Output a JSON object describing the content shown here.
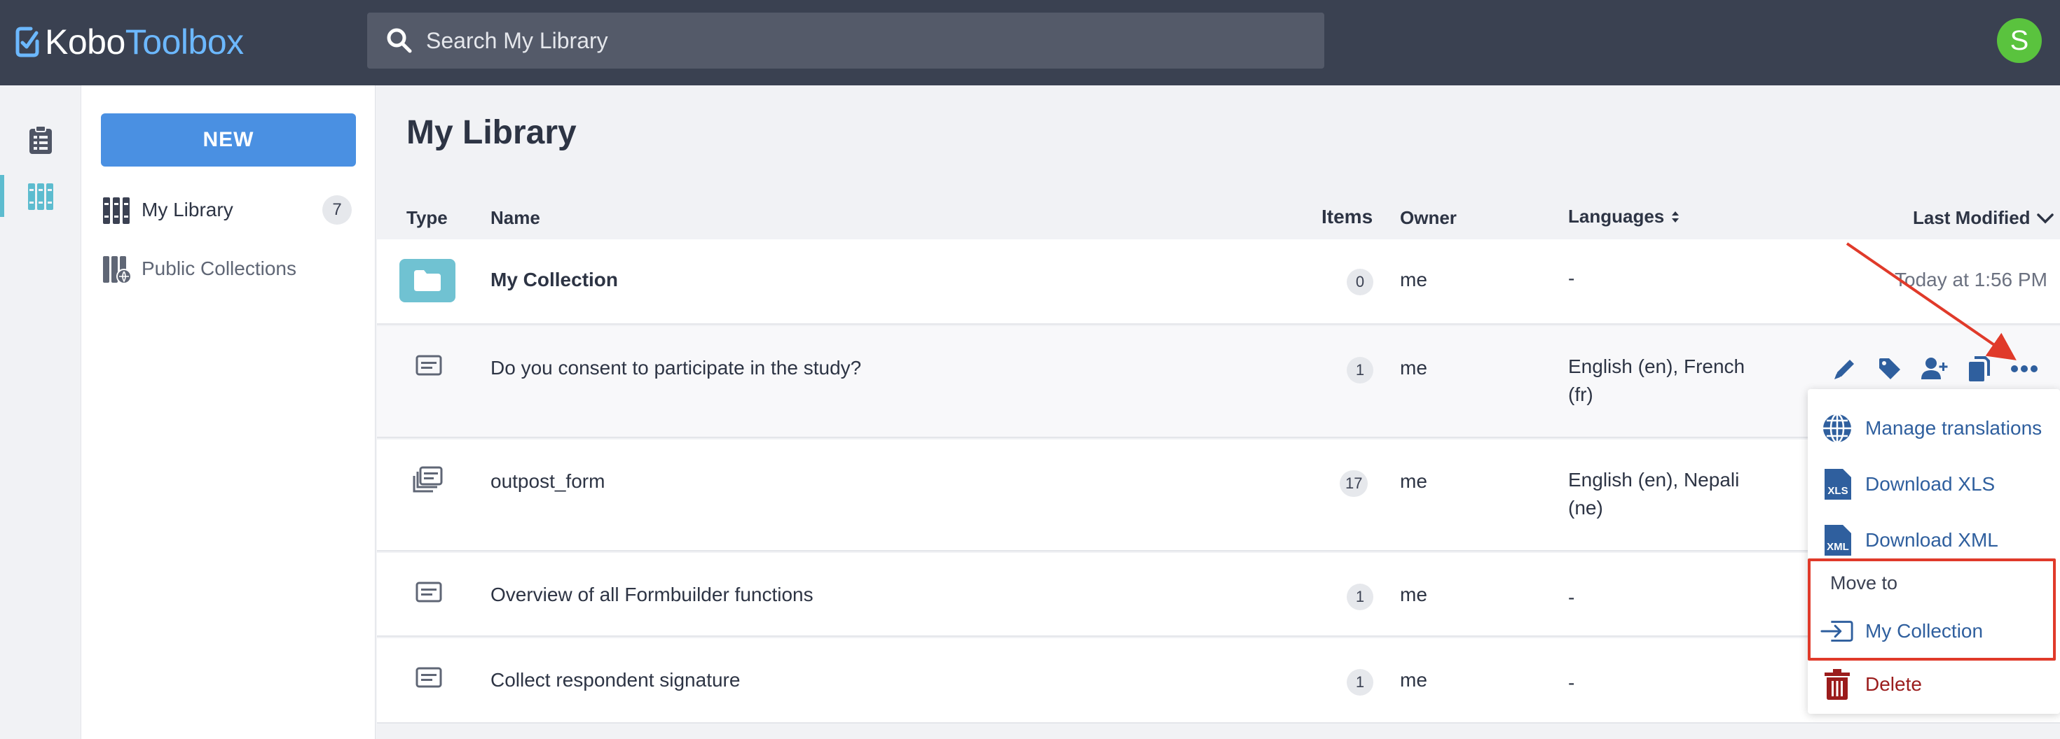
{
  "header": {
    "logo_kobo": "Kobo",
    "logo_toolbox": "Toolbox",
    "search_placeholder": "Search My Library",
    "avatar_initial": "S"
  },
  "sidebar": {
    "new_label": "NEW",
    "items": [
      {
        "label": "My Library",
        "count": "7"
      },
      {
        "label": "Public Collections"
      }
    ]
  },
  "main": {
    "title": "My Library",
    "columns": {
      "type": "Type",
      "name": "Name",
      "items": "Items",
      "owner": "Owner",
      "languages": "Languages",
      "last_modified": "Last Modified"
    },
    "rows": [
      {
        "name": "My Collection",
        "items": "0",
        "owner": "me",
        "languages": "-",
        "modified": "Today at 1:56 PM",
        "type": "collection"
      },
      {
        "name": "Do you consent to participate in the study?",
        "items": "1",
        "owner": "me",
        "languages": "English (en), French (fr)",
        "type": "question"
      },
      {
        "name": "outpost_form",
        "items": "17",
        "owner": "me",
        "languages": "English (en), Nepali (ne)",
        "type": "template"
      },
      {
        "name": "Overview of all Formbuilder functions",
        "items": "1",
        "owner": "me",
        "languages": "-",
        "type": "question"
      },
      {
        "name": "Collect respondent signature",
        "items": "1",
        "owner": "me",
        "languages": "-",
        "type": "question"
      }
    ]
  },
  "menu": {
    "manage_translations": "Manage translations",
    "download_xls": "Download XLS",
    "download_xml": "Download XML",
    "move_to": "Move to",
    "move_target": "My Collection",
    "delete": "Delete"
  },
  "colors": {
    "topbar": "#3a4151",
    "accent_blue": "#4a90e2",
    "folder_teal": "#70c2d2",
    "menu_link": "#2f5f9e",
    "delete_red": "#9b1c1c",
    "annotation_red": "#e03a2a",
    "avatar_green": "#5ac33e"
  }
}
